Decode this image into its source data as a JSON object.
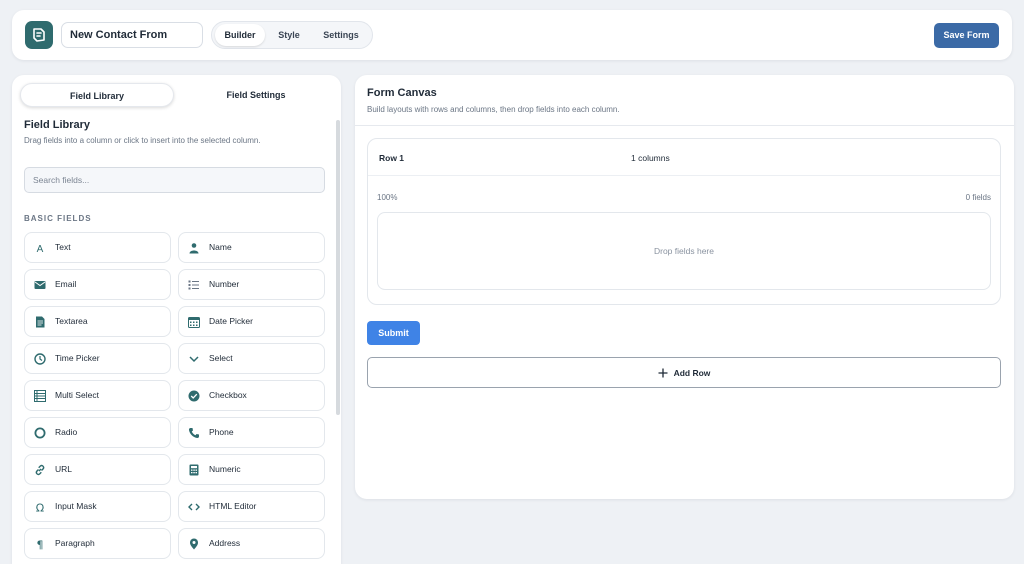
{
  "header": {
    "form_name": "New Contact From",
    "tabs": [
      {
        "label": "Builder",
        "active": true
      },
      {
        "label": "Style",
        "active": false
      },
      {
        "label": "Settings",
        "active": false
      }
    ],
    "save_label": "Save Form"
  },
  "sidebar": {
    "tabs": [
      {
        "label": "Field Library",
        "active": true
      },
      {
        "label": "Field Settings",
        "active": false
      }
    ],
    "title": "Field Library",
    "description": "Drag fields into a column or click to insert into the selected column.",
    "search_placeholder": "Search fields...",
    "section_label": "BASIC FIELDS",
    "fields": [
      {
        "label": "Text",
        "icon": "text-icon"
      },
      {
        "label": "Name",
        "icon": "person-icon"
      },
      {
        "label": "Email",
        "icon": "envelope-icon"
      },
      {
        "label": "Number",
        "icon": "numbered-list-icon"
      },
      {
        "label": "Textarea",
        "icon": "document-icon"
      },
      {
        "label": "Date Picker",
        "icon": "calendar-icon"
      },
      {
        "label": "Time Picker",
        "icon": "clock-icon"
      },
      {
        "label": "Select",
        "icon": "chevron-down-icon"
      },
      {
        "label": "Multi Select",
        "icon": "list-icon"
      },
      {
        "label": "Checkbox",
        "icon": "check-circle-icon"
      },
      {
        "label": "Radio",
        "icon": "radio-icon"
      },
      {
        "label": "Phone",
        "icon": "phone-icon"
      },
      {
        "label": "URL",
        "icon": "link-icon"
      },
      {
        "label": "Numeric",
        "icon": "calculator-icon"
      },
      {
        "label": "Input Mask",
        "icon": "omega-icon"
      },
      {
        "label": "HTML Editor",
        "icon": "code-icon"
      },
      {
        "label": "Paragraph",
        "icon": "pilcrow-icon"
      },
      {
        "label": "Address",
        "icon": "map-pin-icon"
      }
    ]
  },
  "canvas": {
    "title": "Form Canvas",
    "description": "Build layouts with rows and columns, then drop fields into each column.",
    "row": {
      "title": "Row 1",
      "columns_text": "1 columns",
      "column_width": "100%",
      "field_count": "0 fields",
      "drop_text": "Drop fields here"
    },
    "submit_label": "Submit",
    "add_row_label": "Add Row"
  },
  "colors": {
    "accent": "#3b6aa6",
    "submit": "#3f83e6",
    "brand": "#2f6b6e",
    "background": "#eef1f5"
  }
}
